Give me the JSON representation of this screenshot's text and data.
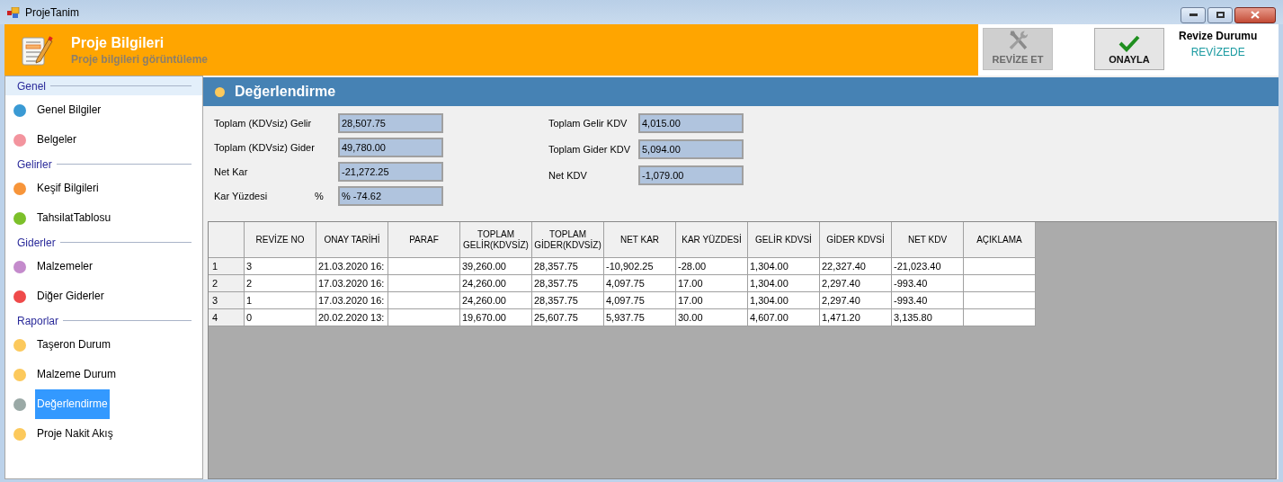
{
  "window": {
    "title": "ProjeTanim"
  },
  "header": {
    "title": "Proje Bilgileri",
    "subtitle": "Proje bilgileri görüntüleme"
  },
  "toolbar": {
    "buttons": [
      {
        "label": "REVİZE ET",
        "kind": "revise",
        "disabled": true
      },
      {
        "label": "ONAYLA",
        "kind": "approve",
        "disabled": false
      }
    ],
    "status_label": "Revize Durumu",
    "status_value": "REVİZEDE"
  },
  "sidebar": {
    "groups": [
      {
        "label": "Genel",
        "highlighted": true,
        "children": [
          {
            "label": "Genel Bilgiler",
            "color": "#3a9ad4",
            "selected": false
          },
          {
            "label": "Belgeler",
            "color": "#f3949e",
            "selected": false
          }
        ]
      },
      {
        "label": "Gelirler",
        "highlighted": false,
        "children": [
          {
            "label": "Keşif Bilgileri",
            "color": "#f7953a",
            "selected": false
          },
          {
            "label": "TahsilatTablosu",
            "color": "#7cc02a",
            "selected": false
          }
        ]
      },
      {
        "label": "Giderler",
        "highlighted": false,
        "children": [
          {
            "label": "Malzemeler",
            "color": "#c48bcc",
            "selected": false
          },
          {
            "label": "Diğer Giderler",
            "color": "#ef4a4a",
            "selected": false
          }
        ]
      },
      {
        "label": "Raporlar",
        "highlighted": false,
        "children": [
          {
            "label": "Taşeron Durum",
            "color": "#fcc95c",
            "selected": false
          },
          {
            "label": "Malzeme Durum",
            "color": "#fcc95c",
            "selected": false
          },
          {
            "label": "Değerlendirme",
            "color": "#9aa9a6",
            "selected": true
          },
          {
            "label": "Proje Nakit Akış",
            "color": "#fcc95c",
            "selected": false
          }
        ]
      }
    ]
  },
  "section": {
    "title": "Değerlendirme"
  },
  "summary": {
    "left": [
      {
        "label": "Toplam (KDVsiz) Gelir",
        "value": "28,507.75"
      },
      {
        "label": "Toplam (KDVsiz) Gider",
        "value": "49,780.00"
      },
      {
        "label": "Net Kar",
        "value": "-21,272.25"
      },
      {
        "label": "Kar Yüzdesi",
        "unit": "%",
        "value": "% -74.62"
      }
    ],
    "right": [
      {
        "label": "Toplam Gelir KDV",
        "value": "4,015.00"
      },
      {
        "label": "Toplam Gider KDV",
        "value": "5,094.00"
      },
      {
        "label": "Net KDV",
        "value": "-1,079.00"
      }
    ]
  },
  "table": {
    "columns": [
      "REVİZE NO",
      "ONAY TARİHİ",
      "PARAF",
      "TOPLAM GELİR(KDVSİZ)",
      "TOPLAM GİDER(KDVSİZ)",
      "NET KAR",
      "KAR YÜZDESİ",
      "GELİR KDVSİ",
      "GİDER KDVSİ",
      "NET KDV",
      "AÇIKLAMA"
    ],
    "rows": [
      {
        "row_header": "1",
        "cells": [
          "3",
          "21.03.2020 16:",
          "",
          "39,260.00",
          "28,357.75",
          "-10,902.25",
          "-28.00",
          "1,304.00",
          "22,327.40",
          "-21,023.40",
          ""
        ]
      },
      {
        "row_header": "2",
        "cells": [
          "2",
          "17.03.2020 16:",
          "",
          "24,260.00",
          "28,357.75",
          "4,097.75",
          "17.00",
          "1,304.00",
          "2,297.40",
          "-993.40",
          ""
        ]
      },
      {
        "row_header": "3",
        "cells": [
          "1",
          "17.03.2020 16:",
          "",
          "24,260.00",
          "28,357.75",
          "4,097.75",
          "17.00",
          "1,304.00",
          "2,297.40",
          "-993.40",
          ""
        ]
      },
      {
        "row_header": "4",
        "cells": [
          "0",
          "20.02.2020 13:",
          "",
          "19,670.00",
          "25,607.75",
          "5,937.75",
          "30.00",
          "4,607.00",
          "1,471.20",
          "3,135.80",
          ""
        ]
      }
    ]
  }
}
